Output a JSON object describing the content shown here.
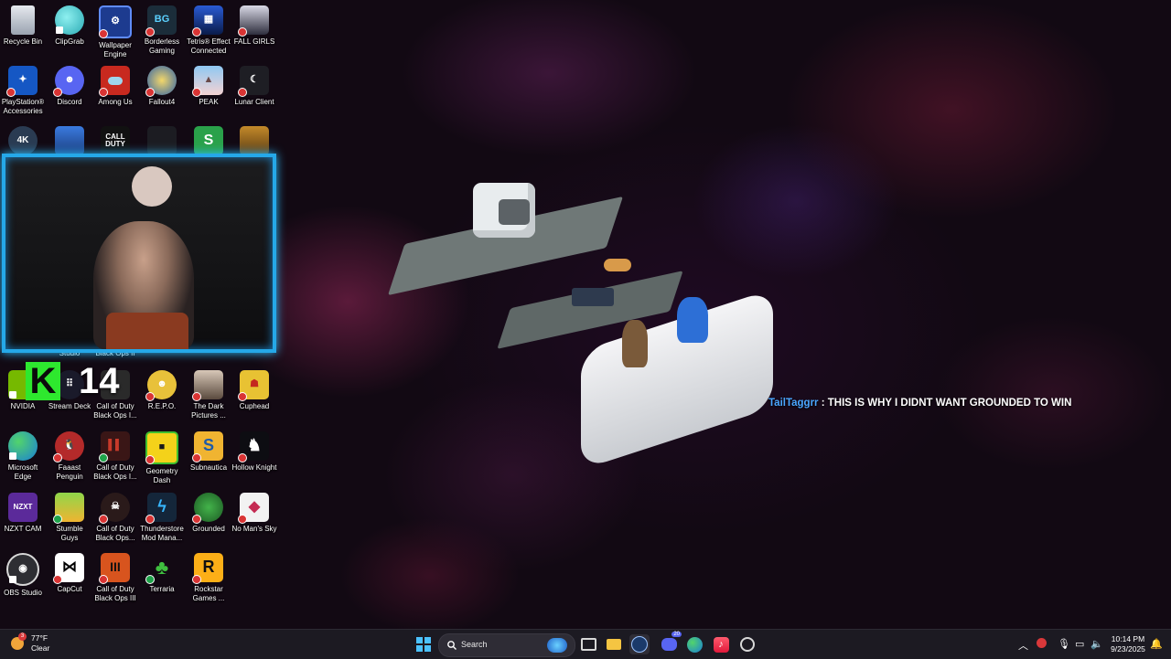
{
  "desktop": {
    "icons": [
      {
        "label": "Recycle Bin",
        "icon": "recycle-bin-icon"
      },
      {
        "label": "ClipGrab",
        "icon": "clipgrab-icon"
      },
      {
        "label": "Wallpaper Engine",
        "icon": "wallpaper-engine-icon"
      },
      {
        "label": "Borderless Gaming",
        "icon": "borderless-gaming-icon",
        "glyph": "BG"
      },
      {
        "label": "Tetris® Effect Connected",
        "icon": "tetris-icon"
      },
      {
        "label": "FALL GIRLS",
        "icon": "fall-girls-icon"
      },
      {
        "label": "PlayStation® Accessories",
        "icon": "playstation-icon"
      },
      {
        "label": "Discord",
        "icon": "discord-icon"
      },
      {
        "label": "Among Us",
        "icon": "among-us-icon"
      },
      {
        "label": "Fallout4",
        "icon": "fallout4-icon"
      },
      {
        "label": "PEAK",
        "icon": "peak-icon"
      },
      {
        "label": "Lunar Client",
        "icon": "lunar-client-icon"
      },
      {
        "label": "Studio",
        "icon": "studio-icon",
        "glyph": "4K"
      },
      {
        "label": "Black Ops II",
        "icon": "rocket-league-icon"
      },
      {
        "label": "",
        "icon": "call-of-duty-icon",
        "glyph": "CALL DUTY"
      },
      {
        "label": "",
        "icon": "dead-by-daylight-icon"
      },
      {
        "label": "",
        "icon": "green-s-icon",
        "glyph": "S"
      },
      {
        "label": "",
        "icon": "ryman-icon"
      },
      {
        "label": "NVIDIA",
        "icon": "nvidia-icon"
      },
      {
        "label": "Stream Deck",
        "icon": "stream-deck-icon"
      },
      {
        "label": "Call of Duty Black Ops I...",
        "icon": "cod-bo-icon"
      },
      {
        "label": "R.E.P.O.",
        "icon": "repo-icon"
      },
      {
        "label": "The Dark Pictures ...",
        "icon": "dark-pictures-icon"
      },
      {
        "label": "Cuphead",
        "icon": "cuphead-icon"
      },
      {
        "label": "Microsoft Edge",
        "icon": "edge-icon"
      },
      {
        "label": "Faaast Penguin",
        "icon": "penguin-icon"
      },
      {
        "label": "Call of Duty Black Ops I...",
        "icon": "cod-bo2-icon"
      },
      {
        "label": "Geometry Dash",
        "icon": "geometry-dash-icon"
      },
      {
        "label": "Subnautica",
        "icon": "subnautica-icon",
        "glyph": "S"
      },
      {
        "label": "Hollow Knight",
        "icon": "hollow-knight-icon"
      },
      {
        "label": "NZXT CAM",
        "icon": "nzxt-icon",
        "glyph": "NZXT"
      },
      {
        "label": "Stumble Guys",
        "icon": "stumble-guys-icon"
      },
      {
        "label": "Call of Duty Black Ops...",
        "icon": "cod-bo3-icon"
      },
      {
        "label": "Thunderstore Mod Mana...",
        "icon": "thunderstore-icon"
      },
      {
        "label": "Grounded",
        "icon": "grounded-icon"
      },
      {
        "label": "No Man's Sky",
        "icon": "no-mans-sky-icon"
      },
      {
        "label": "OBS Studio",
        "icon": "obs-icon"
      },
      {
        "label": "CapCut",
        "icon": "capcut-icon"
      },
      {
        "label": "Call of Duty Black Ops III",
        "icon": "cod-bo3b-icon",
        "glyph": "III"
      },
      {
        "label": "Terraria",
        "icon": "terraria-icon"
      },
      {
        "label": "Rockstar Games ...",
        "icon": "rockstar-icon",
        "glyph": "R"
      }
    ],
    "overlay_glyph": "K",
    "overlay_number": "14"
  },
  "chat": {
    "username": "TailTaggrr",
    "separator": " : ",
    "message": "THIS IS WHY I DIDNT WANT GROUNDED TO WIN"
  },
  "taskbar": {
    "weather_temp": "77°F",
    "weather_desc": "Clear",
    "weather_badge": "3",
    "search_label": "Search",
    "discord_badge": "20",
    "clock_time": "10:14 PM",
    "clock_date": "9/23/2025"
  },
  "colors": {
    "webcam_border": "#25a8e8",
    "chat_username": "#4aa6ff",
    "taskbar_bg": "#1c1a22"
  }
}
